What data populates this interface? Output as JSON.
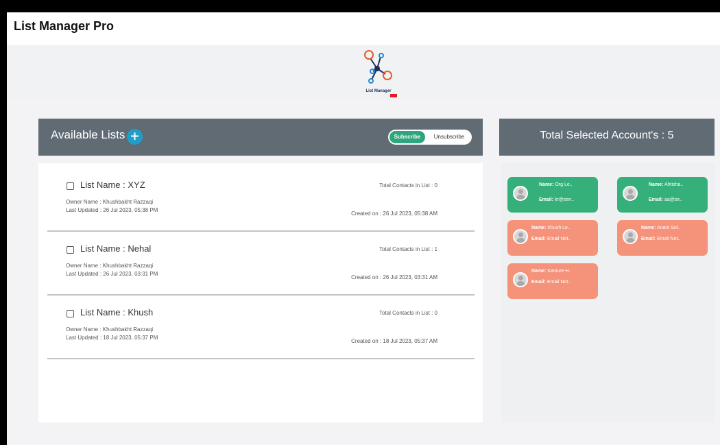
{
  "app": {
    "title": "List Manager Pro"
  },
  "logo": {
    "text": "List Manager",
    "tag_color": "#e31b23"
  },
  "lists_panel": {
    "title": "Available Lists",
    "add_icon": "plus-icon",
    "toggle": {
      "subscribe": "Subscribe",
      "unsubscribe": "Unsubscribe",
      "active": "Subscribe"
    },
    "items": [
      {
        "name": "List Name : XYZ",
        "owner": "Owner Name : Khushbakht Razzaqi",
        "updated": "Last Updated : 26 Jul 2023, 05:38 PM",
        "total": "Total Contacts in List : 0",
        "created": "Created on : 26 Jul 2023, 05:38 AM"
      },
      {
        "name": "List Name : Nehal",
        "owner": "Owner Name : Khushbakht Razzaqi",
        "updated": "Last Updated : 26 Jul 2023, 03:31 PM",
        "total": "Total Contacts in List : 1",
        "created": "Created on : 26 Jul 2023, 03:31 AM"
      },
      {
        "name": "List Name : Khush",
        "owner": "Owner Name : Khushbakht Razzaqi",
        "updated": "Last Updated : 18 Jul 2023, 05:37 PM",
        "total": "Total Contacts in List : 0",
        "created": "Created on : 18 Jul 2023, 05:37 AM"
      }
    ]
  },
  "accounts_panel": {
    "title": "Total Selected Account's : 5",
    "name_label": "Name:",
    "email_label": "Email:",
    "cards": [
      {
        "name": "Org Le..",
        "email": "kr@zen..",
        "status": "green"
      },
      {
        "name": "Ahtisha..",
        "email": "aa@ze..",
        "status": "green"
      },
      {
        "name": "Khush Le..",
        "email": "Email Not..",
        "status": "orange"
      },
      {
        "name": "Anant Sof..",
        "email": "Email Not..",
        "status": "orange"
      },
      {
        "name": "Kasture H..",
        "email": "Email Not..",
        "status": "orange"
      }
    ]
  },
  "colors": {
    "header": "#616b74",
    "green": "#36b07a",
    "orange": "#f4927a",
    "accent": "#1f9fc8"
  }
}
